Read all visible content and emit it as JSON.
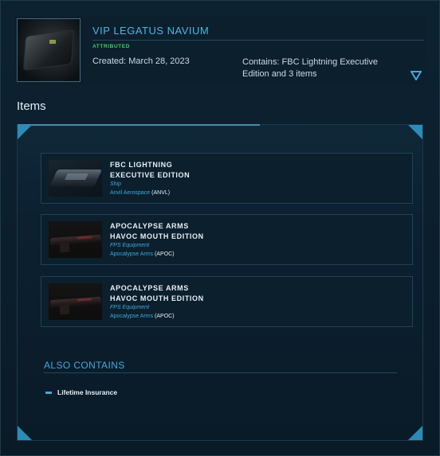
{
  "header": {
    "title": "VIP LEGATUS NAVIUM",
    "badge": "ATTRIBUTED",
    "created": "Created: March 28, 2023",
    "contains": "Contains: FBC Lightning Executive Edition and 3 items"
  },
  "section": {
    "items_heading": "Items"
  },
  "items": [
    {
      "name_line1": "FBC LIGHTNING",
      "name_line2": "EXECUTIVE EDITION",
      "type": "Ship",
      "manufacturer": "Anvil Aerospace",
      "code": "(ANVL)",
      "thumb": "ship"
    },
    {
      "name_line1": "APOCALYPSE ARMS",
      "name_line2": "HAVOC MOUTH EDITION",
      "type": "FPS Equipment",
      "manufacturer": "Apocalypse Arms",
      "code": "(APOC)",
      "thumb": "weapon"
    },
    {
      "name_line1": "APOCALYPSE ARMS",
      "name_line2": "HAVOC MOUTH EDITION",
      "type": "FPS Equipment",
      "manufacturer": "Apocalypse Arms",
      "code": "(APOC)",
      "thumb": "weapon"
    }
  ],
  "also_contains": {
    "heading": "ALSO CONTAINS",
    "items": [
      "Lifetime Insurance"
    ]
  },
  "colors": {
    "accent": "#3fa9de",
    "badge": "#3fd35d",
    "background": "#0a1c2a"
  },
  "icons": {
    "expand": "triangle-down-icon",
    "corner": "corner-bracket-icon"
  }
}
